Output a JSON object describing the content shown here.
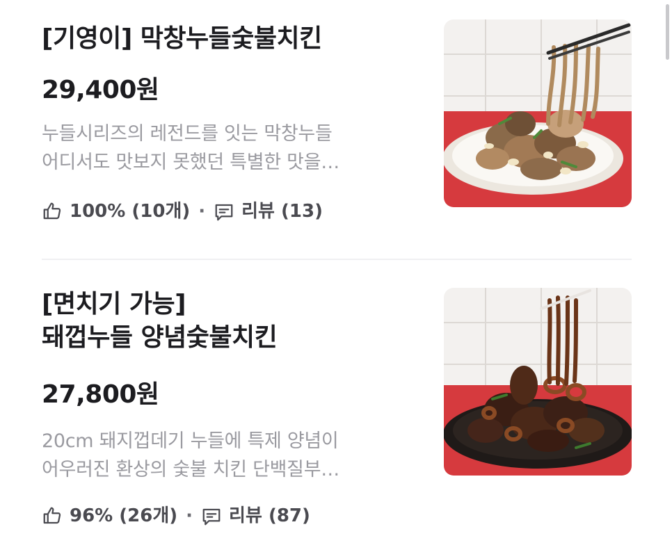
{
  "items": [
    {
      "title_line1": "[기영이] 막창누들숯불치킨",
      "price": "29,400원",
      "desc_line1": "누들시리즈의 레전드를 잇는 막창누들",
      "desc_line2": "어디서도 맛보지 못했던 특별한 맛을…",
      "rating": "100% (10개)",
      "review": "리뷰 (13)",
      "image_icon": "chicken-noodle-plate-photo"
    },
    {
      "title_line1": "[면치기 가능]",
      "title_line2": "돼껍누들 양념숯불치킨",
      "price": "27,800원",
      "desc_line1": "20cm 돼지껍데기 누들에 특제 양념이",
      "desc_line2": "어우러진 환상의 숯불 치킨 단백질부…",
      "rating": "96% (26개)",
      "review": "리뷰 (87)",
      "image_icon": "spicy-chicken-noodle-plate-photo"
    }
  ],
  "separator": "·",
  "icons": {
    "rating": "thumbs-up-icon",
    "review": "chat-bubble-icon"
  },
  "colors": {
    "title": "#1c1c20",
    "desc": "#9a9aa0",
    "meta": "#4a4a50",
    "table_red": "#d63a3e"
  }
}
